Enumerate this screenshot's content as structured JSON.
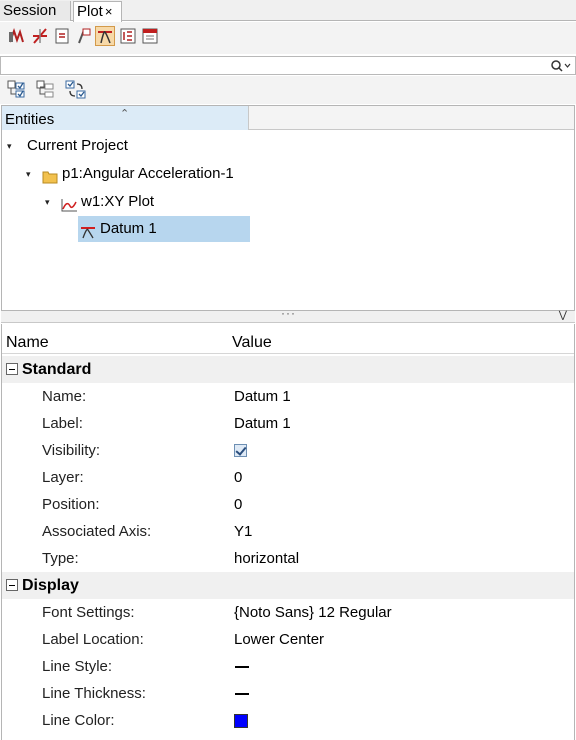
{
  "tabs": {
    "session": "Session",
    "plot": "Plot",
    "close_glyph": "×"
  },
  "search": {
    "value": "",
    "placeholder": ""
  },
  "tree": {
    "header": "Entities",
    "project": "Current Project",
    "page": "p1:Angular Acceleration-1",
    "window": "w1:XY Plot",
    "datum": "Datum 1"
  },
  "properties": {
    "col_name": "Name",
    "col_value": "Value",
    "standard": {
      "label": "Standard",
      "rows": [
        {
          "name": "Name:",
          "value": "Datum 1"
        },
        {
          "name": "Label:",
          "value": "Datum 1"
        },
        {
          "name": "Visibility:",
          "value": "checked"
        },
        {
          "name": "Layer:",
          "value": "0"
        },
        {
          "name": "Position:",
          "value": "0"
        },
        {
          "name": "Associated Axis:",
          "value": "Y1"
        },
        {
          "name": "Type:",
          "value": "horizontal"
        }
      ]
    },
    "display": {
      "label": "Display",
      "rows": [
        {
          "name": "Font Settings:",
          "value": "{Noto Sans} 12 Regular"
        },
        {
          "name": "Label Location:",
          "value": "Lower Center"
        },
        {
          "name": "Line Style:",
          "value": "solid-line"
        },
        {
          "name": "Line Thickness:",
          "value": "thin-line"
        },
        {
          "name": "Line Color:",
          "value": "#0000ff"
        }
      ]
    }
  },
  "colors": {
    "selection": "#b7d6ee",
    "accent": "#d02020",
    "line_color": "#0000ff"
  }
}
